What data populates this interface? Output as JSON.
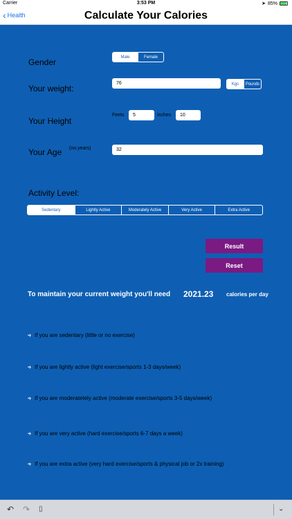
{
  "status": {
    "carrier": "Carrier",
    "time": "3:53 PM",
    "battery": "85%"
  },
  "nav": {
    "back_label": "Health",
    "title": "Calculate Your Calories"
  },
  "gender": {
    "label": "Gender",
    "options": [
      "Male",
      "Female"
    ],
    "selected": "Male"
  },
  "weight": {
    "label": "Your weight:",
    "value": "76",
    "units": [
      "Kgs",
      "Pounds"
    ],
    "selected_unit": "Kgs"
  },
  "height": {
    "label": "Your Height",
    "feet_label": "Feets",
    "feet_value": "5",
    "inches_label": "inches",
    "inches_value": "10"
  },
  "age": {
    "label": "Your Age",
    "hint": "(no.years)",
    "value": "32"
  },
  "activity": {
    "label": "Activity Level:",
    "options": [
      "Sedentary",
      "Lightly Active",
      "Moderately Active",
      "Very Active",
      "Extra Active"
    ],
    "selected": "Sedentary"
  },
  "buttons": {
    "result": "Result",
    "reset": "Reset"
  },
  "result": {
    "maintain_text": "To maintain your current weight you'll need",
    "value": "2021.23",
    "unit": "calories per day"
  },
  "levels": [
    {
      "arrow": "-›",
      "text": "If you are sedentary (little or no exercise)"
    },
    {
      "arrow": "-›",
      "text": "If you are lightly active (light exercise/sports 1-3 days/week)"
    },
    {
      "arrow": "-›",
      "text": "If you are moderatetely active (moderate exercise/sports 3-5 days/week)"
    },
    {
      "arrow": "-›",
      "text": "If you are very active (hard exercise/sports 6-7 days a week)"
    },
    {
      "arrow": "-›",
      "text": "If you are extra active (very hard exercise/sports & physical job or 2x training)"
    }
  ],
  "toolbar": {
    "undo_icon": "undo-icon",
    "redo_icon": "redo-icon",
    "paste_icon": "clipboard-icon",
    "collapse_icon": "chevron-down-icon"
  }
}
